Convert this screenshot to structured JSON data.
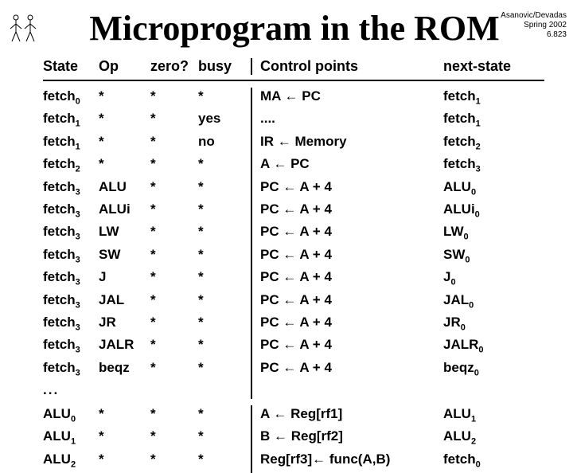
{
  "course": {
    "line1": "Asanovic/Devadas",
    "line2": "Spring 2002",
    "line3": "6.823"
  },
  "title": "Microprogram in the ROM",
  "headers": {
    "state": "State",
    "op": "Op",
    "zero": "zero?",
    "busy": "busy",
    "cp": "Control points",
    "next": "next-state"
  },
  "rows": [
    {
      "state": "fetch",
      "ssub": "0",
      "op": "*",
      "zero": "*",
      "busy": "*",
      "cp": "MA ← PC",
      "next": "fetch",
      "nsub": "1"
    },
    {
      "state": "fetch",
      "ssub": "1",
      "op": "*",
      "zero": "*",
      "busy": "yes",
      "cp": "....",
      "next": "fetch",
      "nsub": "1"
    },
    {
      "state": "fetch",
      "ssub": "1",
      "op": "*",
      "zero": "*",
      "busy": "no",
      "cp": "IR ← Memory",
      "next": "fetch",
      "nsub": "2"
    },
    {
      "state": "fetch",
      "ssub": "2",
      "op": "*",
      "zero": "*",
      "busy": "*",
      "cp": "A ← PC",
      "next": "fetch",
      "nsub": "3"
    },
    {
      "state": "fetch",
      "ssub": "3",
      "op": "ALU",
      "zero": "*",
      "busy": "*",
      "cp": "PC ← A + 4",
      "next": "ALU",
      "nsub": "0"
    },
    {
      "state": "fetch",
      "ssub": "3",
      "op": "ALUi",
      "zero": "*",
      "busy": "*",
      "cp": "PC ← A + 4",
      "next": "ALUi",
      "nsub": "0"
    },
    {
      "state": "fetch",
      "ssub": "3",
      "op": "LW",
      "zero": "*",
      "busy": "*",
      "cp": "PC ← A + 4",
      "next": "LW",
      "nsub": "0"
    },
    {
      "state": "fetch",
      "ssub": "3",
      "op": "SW",
      "zero": "*",
      "busy": "*",
      "cp": "PC ← A + 4",
      "next": "SW",
      "nsub": "0"
    },
    {
      "state": "fetch",
      "ssub": "3",
      "op": "J",
      "zero": "*",
      "busy": "*",
      "cp": "PC ← A + 4",
      "next": "J",
      "nsub": "0"
    },
    {
      "state": "fetch",
      "ssub": "3",
      "op": "JAL",
      "zero": "*",
      "busy": "*",
      "cp": "PC ← A + 4",
      "next": "JAL",
      "nsub": "0"
    },
    {
      "state": "fetch",
      "ssub": "3",
      "op": "JR",
      "zero": "*",
      "busy": "*",
      "cp": "PC ← A + 4",
      "next": "JR",
      "nsub": "0"
    },
    {
      "state": "fetch",
      "ssub": "3",
      "op": "JALR",
      "zero": "*",
      "busy": "*",
      "cp": "PC ← A + 4",
      "next": "JALR",
      "nsub": "0"
    },
    {
      "state": "fetch",
      "ssub": "3",
      "op": "beqz",
      "zero": "*",
      "busy": "*",
      "cp": "PC ← A + 4",
      "next": "beqz",
      "nsub": "0"
    }
  ],
  "ellipsis": "...",
  "rows2": [
    {
      "state": "ALU",
      "ssub": "0",
      "op": "*",
      "zero": "*",
      "busy": "*",
      "cp": "A ← Reg[rf1]",
      "next": "ALU",
      "nsub": "1"
    },
    {
      "state": "ALU",
      "ssub": "1",
      "op": "*",
      "zero": "*",
      "busy": "*",
      "cp": "B ← Reg[rf2]",
      "next": "ALU",
      "nsub": "2"
    },
    {
      "state": "ALU",
      "ssub": "2",
      "op": "*",
      "zero": "*",
      "busy": "*",
      "cp": "Reg[rf3]← func(A,B)",
      "next": "fetch",
      "nsub": "0"
    }
  ]
}
